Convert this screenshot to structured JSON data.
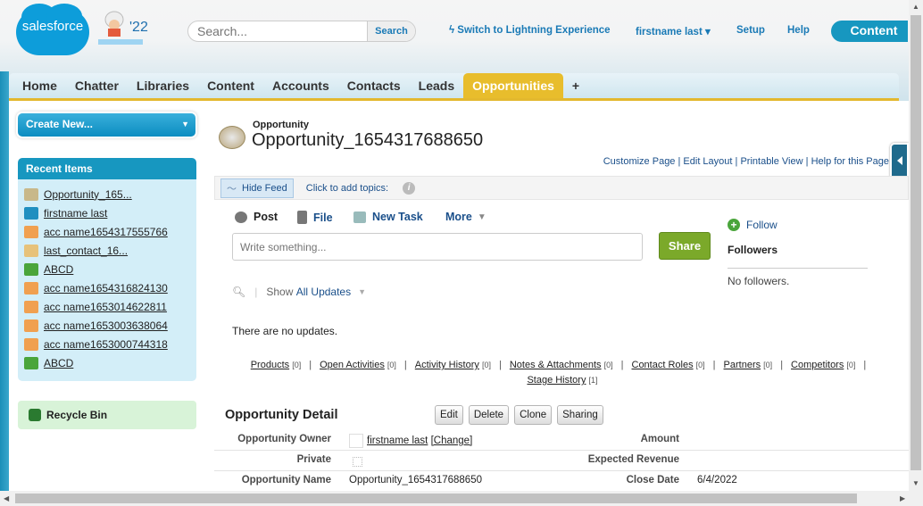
{
  "header": {
    "logo_text": "salesforce",
    "release_badge": "'22",
    "search_placeholder": "Search...",
    "search_button": "Search",
    "lightning_link": "Switch to Lightning Experience",
    "user_menu": "firstname last",
    "setup": "Setup",
    "help": "Help",
    "app_menu": "Content"
  },
  "tabs": [
    "Home",
    "Chatter",
    "Libraries",
    "Content",
    "Accounts",
    "Contacts",
    "Leads",
    "Opportunities",
    "+"
  ],
  "active_tab": "Opportunities",
  "sidebar": {
    "create_new": "Create New...",
    "recent_title": "Recent Items",
    "recent_items": [
      {
        "label": "Opportunity_165...",
        "icon": "opportunity-icon",
        "color": "#c8b88a"
      },
      {
        "label": "firstname last",
        "icon": "user-icon",
        "color": "#1f8fc0"
      },
      {
        "label": "acc name1654317555766",
        "icon": "account-icon",
        "color": "#f0a050"
      },
      {
        "label": "last_contact_16...",
        "icon": "contact-icon",
        "color": "#e7c27a"
      },
      {
        "label": "ABCD",
        "icon": "lead-icon",
        "color": "#4aa53b"
      },
      {
        "label": "acc name1654316824130",
        "icon": "account-icon",
        "color": "#f0a050"
      },
      {
        "label": "acc name1653014622811",
        "icon": "account-icon",
        "color": "#f0a050"
      },
      {
        "label": "acc name1653003638064",
        "icon": "account-icon",
        "color": "#f0a050"
      },
      {
        "label": "acc name1653000744318",
        "icon": "account-icon",
        "color": "#f0a050"
      },
      {
        "label": "ABCD",
        "icon": "lead-icon",
        "color": "#4aa53b"
      }
    ],
    "recycle_bin": "Recycle Bin"
  },
  "page": {
    "object_label": "Opportunity",
    "title": "Opportunity_1654317688650",
    "links": [
      "Customize Page",
      "Edit Layout",
      "Printable View",
      "Help for this Page"
    ]
  },
  "feed": {
    "hide_feed": "Hide Feed",
    "add_topics": "Click to add topics:",
    "publishers": [
      "Post",
      "File",
      "New Task",
      "More"
    ],
    "write_placeholder": "Write something...",
    "share": "Share",
    "show_label": "Show",
    "show_value": "All Updates",
    "no_updates": "There are no updates.",
    "follow": "Follow",
    "followers": "Followers",
    "no_followers": "No followers."
  },
  "related_lists": [
    {
      "label": "Products",
      "count": "[0]"
    },
    {
      "label": "Open Activities",
      "count": "[0]"
    },
    {
      "label": "Activity History",
      "count": "[0]"
    },
    {
      "label": "Notes & Attachments",
      "count": "[0]"
    },
    {
      "label": "Contact Roles",
      "count": "[0]"
    },
    {
      "label": "Partners",
      "count": "[0]"
    },
    {
      "label": "Competitors",
      "count": "[0]"
    },
    {
      "label": "Stage History",
      "count": "[1]"
    }
  ],
  "detail": {
    "title": "Opportunity Detail",
    "buttons": [
      "Edit",
      "Delete",
      "Clone",
      "Sharing"
    ],
    "rows": [
      {
        "label": "Opportunity Owner",
        "value": "firstname last",
        "extra": "[Change]",
        "label2": "Amount",
        "value2": ""
      },
      {
        "label": "Private",
        "value": "",
        "label2": "Expected Revenue",
        "value2": ""
      },
      {
        "label": "Opportunity Name",
        "value": "Opportunity_1654317688650",
        "label2": "Close Date",
        "value2": "6/4/2022"
      }
    ]
  }
}
